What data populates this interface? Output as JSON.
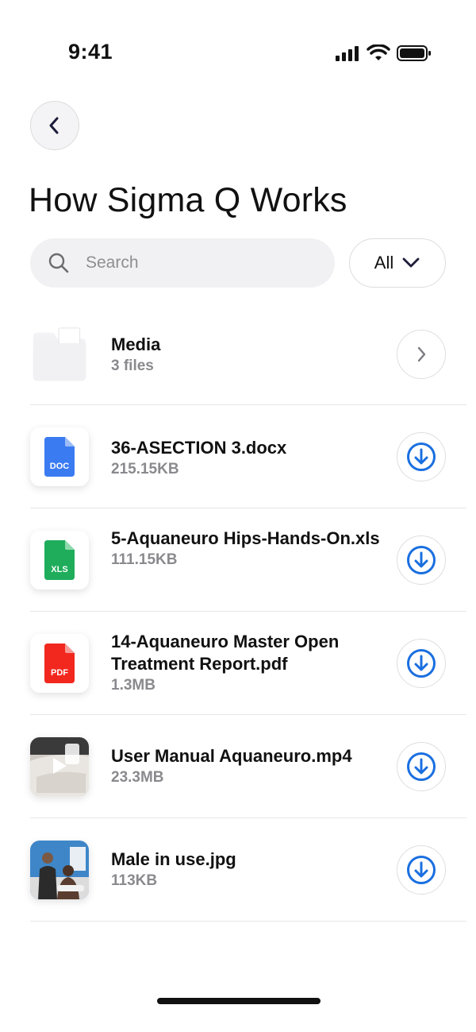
{
  "status_bar": {
    "time": "9:41",
    "icons": [
      "signal-icon",
      "wifi-icon",
      "battery-icon"
    ]
  },
  "header": {
    "back_icon": "chevron-left-icon",
    "title": "How Sigma Q Works"
  },
  "search": {
    "placeholder": "Search",
    "icon": "search-icon"
  },
  "filter": {
    "label": "All",
    "icon": "chevron-down-icon"
  },
  "files": [
    {
      "name": "Media",
      "meta": "3 files",
      "kind": "folder",
      "action": "chevron-right-icon"
    },
    {
      "name": "36-ASECTION 3.docx",
      "meta": "215.15KB",
      "kind": "doc",
      "badge": "DOC",
      "color": "#3b7bf2",
      "action": "download-icon"
    },
    {
      "name": "5-Aquaneuro Hips-Hands-On.xls",
      "meta": "111.15KB",
      "kind": "xls",
      "badge": "XLS",
      "color": "#1fad5b",
      "action": "download-icon"
    },
    {
      "name": "14-Aquaneuro Master Open Treatment Report.pdf",
      "meta": "1.3MB",
      "kind": "pdf",
      "badge": "PDF",
      "color": "#f2281e",
      "action": "download-icon"
    },
    {
      "name": "User Manual Aquaneuro.mp4",
      "meta": "23.3MB",
      "kind": "video",
      "action": "download-icon"
    },
    {
      "name": "Male in use.jpg",
      "meta": "113KB",
      "kind": "image",
      "action": "download-icon"
    }
  ],
  "colors": {
    "accent": "#1a6fe0",
    "muted_text": "#8a8a8e",
    "divider": "#e6e6e6"
  }
}
